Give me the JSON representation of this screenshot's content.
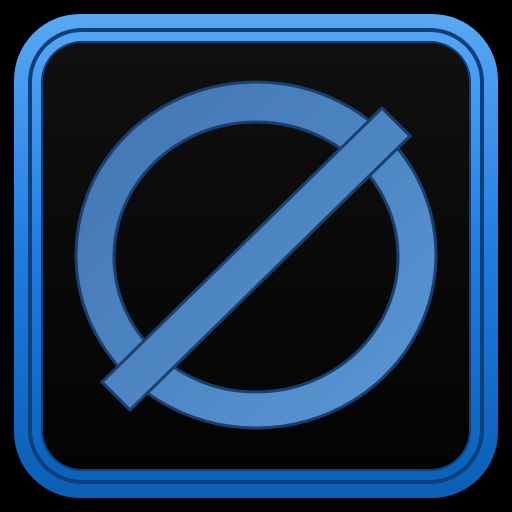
{
  "icon": {
    "name": "empty-set-icon",
    "symbol": "Ø"
  },
  "colors": {
    "background": "#000000",
    "frame_outer": "#0a5fb5",
    "frame_main": "#1f7be0",
    "frame_light": "#5aa8f5",
    "frame_inner_border": "#0d3f7a",
    "panel_top": "#101010",
    "panel_bottom": "#030303",
    "glyph_light": "#5b97d6",
    "glyph_dark": "#3f74b0",
    "glyph_outline": "#1b3f6e"
  }
}
